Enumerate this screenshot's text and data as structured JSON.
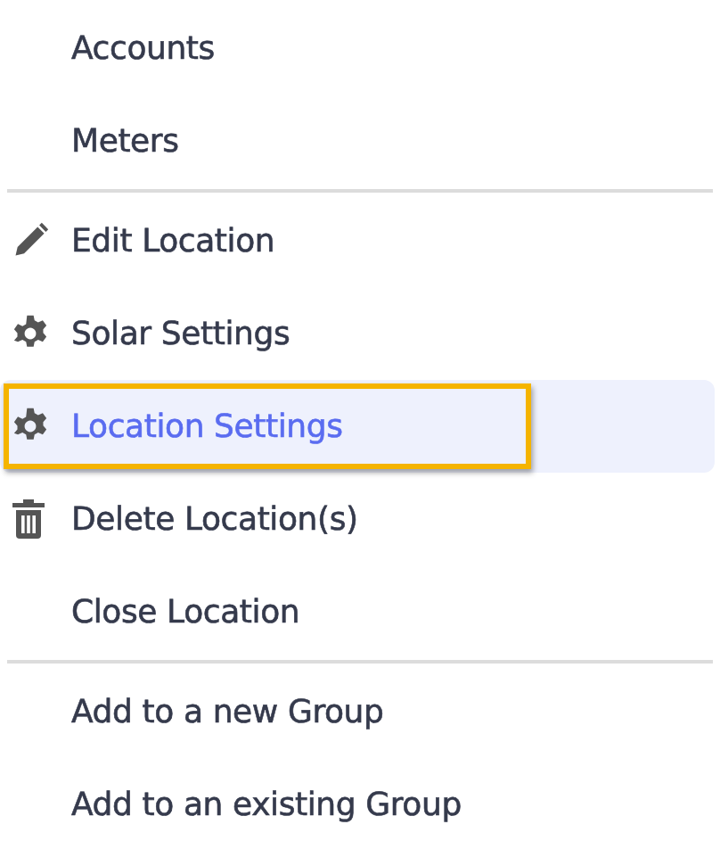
{
  "menu": {
    "sections": [
      {
        "items": [
          {
            "label": "Accounts",
            "kind": "plain",
            "selected": false
          },
          {
            "label": "Meters",
            "kind": "plain",
            "selected": false
          }
        ]
      },
      {
        "items": [
          {
            "label": "Edit Location",
            "kind": "edit",
            "selected": false
          },
          {
            "label": "Solar Settings",
            "kind": "settings",
            "selected": false
          },
          {
            "label": "Location Settings",
            "kind": "settings",
            "selected": true
          },
          {
            "label": "Delete Location(s)",
            "kind": "delete",
            "selected": false
          },
          {
            "label": "Close Location",
            "kind": "plain",
            "selected": false
          }
        ]
      },
      {
        "items": [
          {
            "label": "Add to a new Group",
            "kind": "plain",
            "selected": false
          },
          {
            "label": "Add to an existing Group",
            "kind": "plain",
            "selected": false
          }
        ]
      }
    ]
  }
}
